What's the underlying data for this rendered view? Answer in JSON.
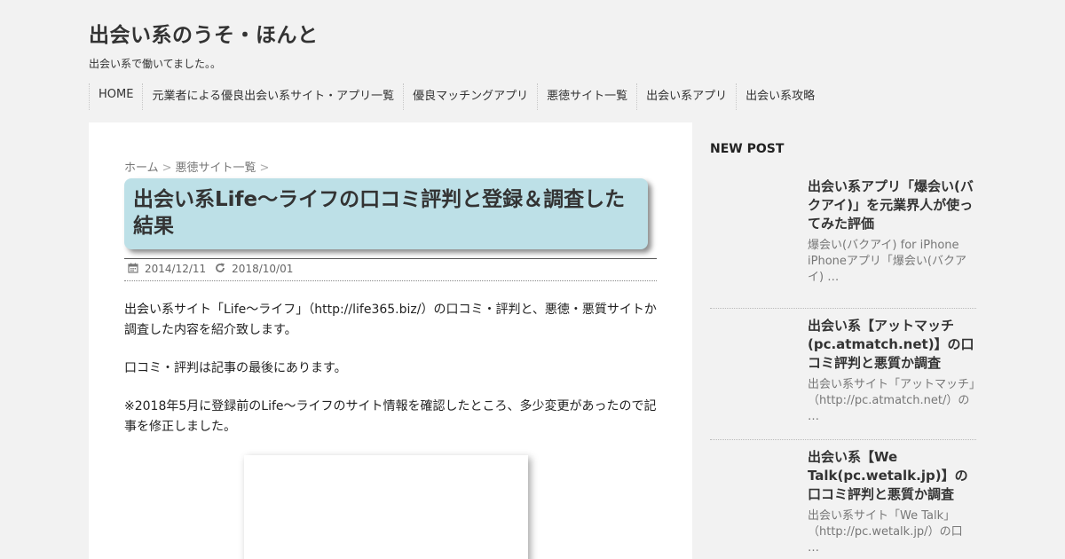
{
  "site": {
    "title": "出会い系のうそ・ほんと",
    "description": "出会い系で働いてました。。"
  },
  "nav": {
    "items": [
      {
        "label": "HOME"
      },
      {
        "label": "元業者による優良出会い系サイト・アプリ一覧"
      },
      {
        "label": "優良マッチングアプリ"
      },
      {
        "label": "悪徳サイト一覧"
      },
      {
        "label": "出会い系アプリ"
      },
      {
        "label": "出会い系攻略"
      }
    ]
  },
  "breadcrumb": {
    "home": "ホーム",
    "sep": ">",
    "category": "悪徳サイト一覧"
  },
  "article": {
    "title": "出会い系Life～ライフの口コミ評判と登録＆調査した結果",
    "published": "2014/12/11",
    "updated": "2018/10/01",
    "paragraphs": [
      "出会い系サイト「Life～ライフ」（http://life365.biz/）の口コミ・評判と、悪徳・悪質サイトか調査した内容を紹介致します。",
      "口コミ・評判は記事の最後にあります。",
      "※2018年5月に登録前のLife～ライフのサイト情報を確認したところ、多少変更があったので記事を修正しました。"
    ]
  },
  "sidebar": {
    "heading": "NEW POST",
    "posts": [
      {
        "title": "出会い系アプリ「爆会い(バクアイ)」を元業界人が使ってみた評価",
        "excerpt": "爆会い(バクアイ) for iPhone iPhoneアプリ「爆会い(バクアイ) …"
      },
      {
        "title": "出会い系【アットマッチ(pc.atmatch.net)】の口コミ評判と悪質か調査",
        "excerpt": "出会い系サイト「アットマッチ」（http://pc.atmatch.net/）の …"
      },
      {
        "title": "出会い系【We Talk(pc.wetalk.jp)】の口コミ評判と悪質か調査",
        "excerpt": "出会い系サイト「We Talk」（http://pc.wetalk.jp/）の口 …"
      }
    ]
  },
  "colors": {
    "page_bg": "#f2f2f2",
    "title_box_bg": "#bde0e7",
    "text": "#333333"
  }
}
